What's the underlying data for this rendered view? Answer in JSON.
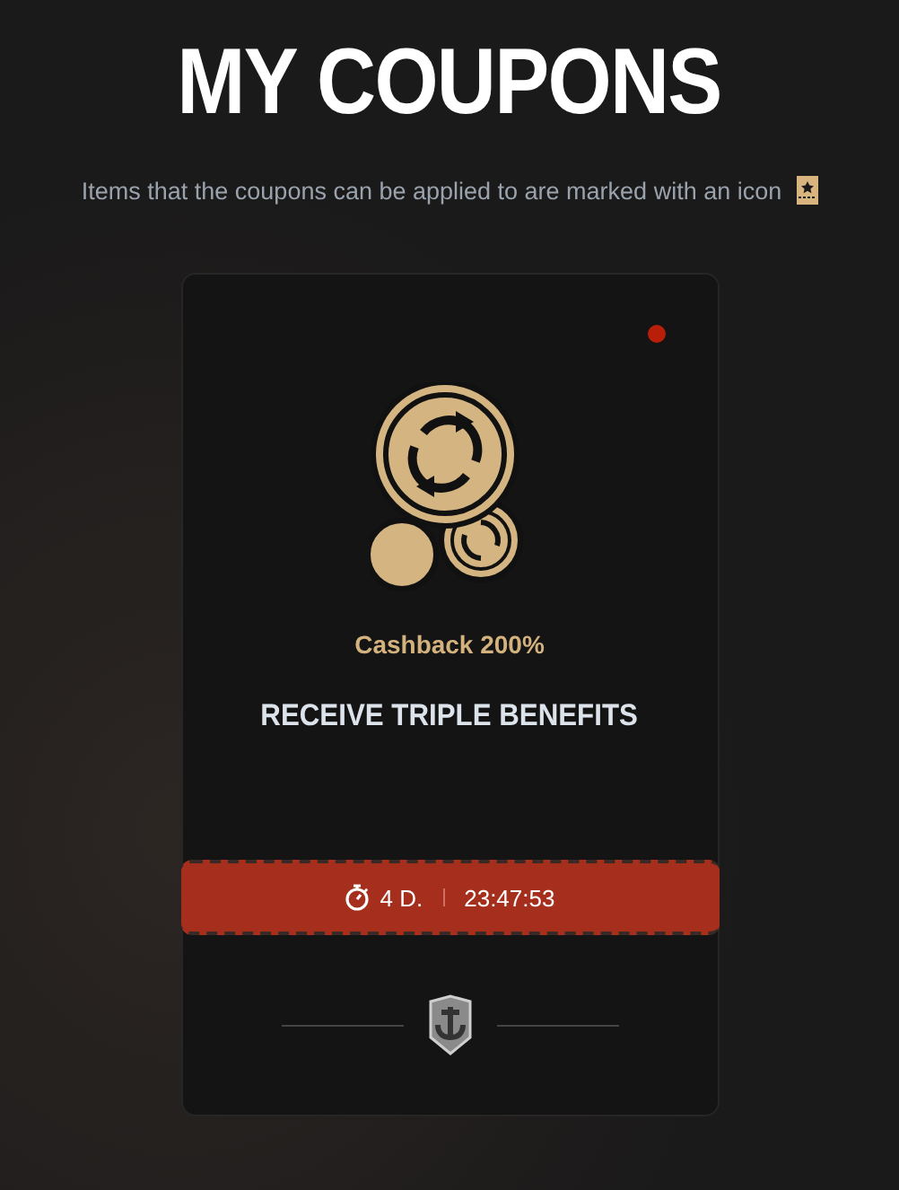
{
  "title": "MY COUPONS",
  "subtitle": "Items that the coupons can be applied to are marked with an icon",
  "coupon": {
    "new": true,
    "name": "Cashback 200%",
    "description": "RECEIVE TRIPLE BENEFITS",
    "timer": {
      "days": "4 D.",
      "time": "23:47:53"
    }
  }
}
